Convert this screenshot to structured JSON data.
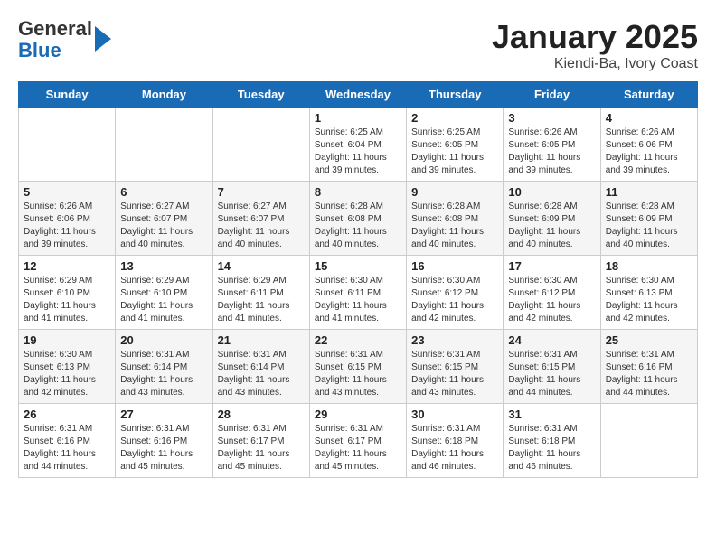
{
  "header": {
    "logo_line1": "General",
    "logo_line2": "Blue",
    "title": "January 2025",
    "subtitle": "Kiendi-Ba, Ivory Coast"
  },
  "days_of_week": [
    "Sunday",
    "Monday",
    "Tuesday",
    "Wednesday",
    "Thursday",
    "Friday",
    "Saturday"
  ],
  "weeks": [
    [
      {
        "day": "",
        "info": ""
      },
      {
        "day": "",
        "info": ""
      },
      {
        "day": "",
        "info": ""
      },
      {
        "day": "1",
        "info": "Sunrise: 6:25 AM\nSunset: 6:04 PM\nDaylight: 11 hours\nand 39 minutes."
      },
      {
        "day": "2",
        "info": "Sunrise: 6:25 AM\nSunset: 6:05 PM\nDaylight: 11 hours\nand 39 minutes."
      },
      {
        "day": "3",
        "info": "Sunrise: 6:26 AM\nSunset: 6:05 PM\nDaylight: 11 hours\nand 39 minutes."
      },
      {
        "day": "4",
        "info": "Sunrise: 6:26 AM\nSunset: 6:06 PM\nDaylight: 11 hours\nand 39 minutes."
      }
    ],
    [
      {
        "day": "5",
        "info": "Sunrise: 6:26 AM\nSunset: 6:06 PM\nDaylight: 11 hours\nand 39 minutes."
      },
      {
        "day": "6",
        "info": "Sunrise: 6:27 AM\nSunset: 6:07 PM\nDaylight: 11 hours\nand 40 minutes."
      },
      {
        "day": "7",
        "info": "Sunrise: 6:27 AM\nSunset: 6:07 PM\nDaylight: 11 hours\nand 40 minutes."
      },
      {
        "day": "8",
        "info": "Sunrise: 6:28 AM\nSunset: 6:08 PM\nDaylight: 11 hours\nand 40 minutes."
      },
      {
        "day": "9",
        "info": "Sunrise: 6:28 AM\nSunset: 6:08 PM\nDaylight: 11 hours\nand 40 minutes."
      },
      {
        "day": "10",
        "info": "Sunrise: 6:28 AM\nSunset: 6:09 PM\nDaylight: 11 hours\nand 40 minutes."
      },
      {
        "day": "11",
        "info": "Sunrise: 6:28 AM\nSunset: 6:09 PM\nDaylight: 11 hours\nand 40 minutes."
      }
    ],
    [
      {
        "day": "12",
        "info": "Sunrise: 6:29 AM\nSunset: 6:10 PM\nDaylight: 11 hours\nand 41 minutes."
      },
      {
        "day": "13",
        "info": "Sunrise: 6:29 AM\nSunset: 6:10 PM\nDaylight: 11 hours\nand 41 minutes."
      },
      {
        "day": "14",
        "info": "Sunrise: 6:29 AM\nSunset: 6:11 PM\nDaylight: 11 hours\nand 41 minutes."
      },
      {
        "day": "15",
        "info": "Sunrise: 6:30 AM\nSunset: 6:11 PM\nDaylight: 11 hours\nand 41 minutes."
      },
      {
        "day": "16",
        "info": "Sunrise: 6:30 AM\nSunset: 6:12 PM\nDaylight: 11 hours\nand 42 minutes."
      },
      {
        "day": "17",
        "info": "Sunrise: 6:30 AM\nSunset: 6:12 PM\nDaylight: 11 hours\nand 42 minutes."
      },
      {
        "day": "18",
        "info": "Sunrise: 6:30 AM\nSunset: 6:13 PM\nDaylight: 11 hours\nand 42 minutes."
      }
    ],
    [
      {
        "day": "19",
        "info": "Sunrise: 6:30 AM\nSunset: 6:13 PM\nDaylight: 11 hours\nand 42 minutes."
      },
      {
        "day": "20",
        "info": "Sunrise: 6:31 AM\nSunset: 6:14 PM\nDaylight: 11 hours\nand 43 minutes."
      },
      {
        "day": "21",
        "info": "Sunrise: 6:31 AM\nSunset: 6:14 PM\nDaylight: 11 hours\nand 43 minutes."
      },
      {
        "day": "22",
        "info": "Sunrise: 6:31 AM\nSunset: 6:15 PM\nDaylight: 11 hours\nand 43 minutes."
      },
      {
        "day": "23",
        "info": "Sunrise: 6:31 AM\nSunset: 6:15 PM\nDaylight: 11 hours\nand 43 minutes."
      },
      {
        "day": "24",
        "info": "Sunrise: 6:31 AM\nSunset: 6:15 PM\nDaylight: 11 hours\nand 44 minutes."
      },
      {
        "day": "25",
        "info": "Sunrise: 6:31 AM\nSunset: 6:16 PM\nDaylight: 11 hours\nand 44 minutes."
      }
    ],
    [
      {
        "day": "26",
        "info": "Sunrise: 6:31 AM\nSunset: 6:16 PM\nDaylight: 11 hours\nand 44 minutes."
      },
      {
        "day": "27",
        "info": "Sunrise: 6:31 AM\nSunset: 6:16 PM\nDaylight: 11 hours\nand 45 minutes."
      },
      {
        "day": "28",
        "info": "Sunrise: 6:31 AM\nSunset: 6:17 PM\nDaylight: 11 hours\nand 45 minutes."
      },
      {
        "day": "29",
        "info": "Sunrise: 6:31 AM\nSunset: 6:17 PM\nDaylight: 11 hours\nand 45 minutes."
      },
      {
        "day": "30",
        "info": "Sunrise: 6:31 AM\nSunset: 6:18 PM\nDaylight: 11 hours\nand 46 minutes."
      },
      {
        "day": "31",
        "info": "Sunrise: 6:31 AM\nSunset: 6:18 PM\nDaylight: 11 hours\nand 46 minutes."
      },
      {
        "day": "",
        "info": ""
      }
    ]
  ]
}
